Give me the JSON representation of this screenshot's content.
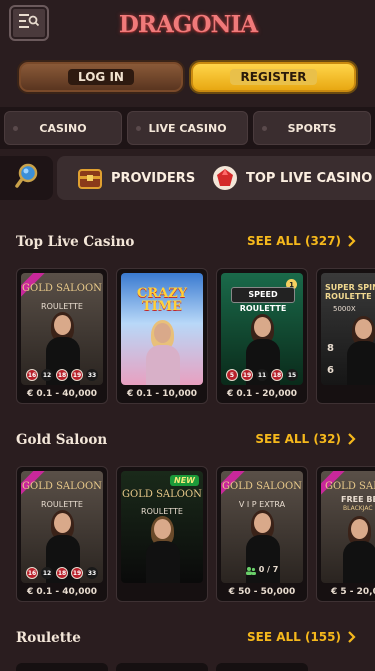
{
  "header": {
    "logo_text": "DRAGONIA",
    "menu_icon": "menu-list-icon"
  },
  "auth": {
    "login_label": "LOG IN",
    "register_label": "REGISTER"
  },
  "nav": {
    "tabs": [
      {
        "label": "CASINO"
      },
      {
        "label": "LIVE CASINO",
        "active": true
      },
      {
        "label": "SPORTS"
      }
    ]
  },
  "filters": {
    "search_icon": "magnifier-icon",
    "items": [
      {
        "label": "PROVIDERS",
        "icon": "chest-icon"
      },
      {
        "label": "TOP LIVE CASINO",
        "icon": "ruby-icon"
      }
    ]
  },
  "sections": [
    {
      "title": "Top Live Casino",
      "see_all": "SEE ALL (327)",
      "cards": [
        {
          "title": "GOLD SALOON",
          "subtitle": "ROULETTE",
          "balls": [
            "16",
            "12",
            "18",
            "19",
            "33"
          ],
          "limit": "€ 0.1 - 40,000",
          "ribbon": true
        },
        {
          "title": "CRAZY TIME",
          "limit": "€ 0.1 - 10,000"
        },
        {
          "title": "SPEED ROULETTE",
          "badge_number": "1",
          "balls": [
            "5",
            "19",
            "11",
            "18",
            "15"
          ],
          "limit": "€ 0.1 - 20,000"
        },
        {
          "title": "SUPER SPIN ROULETTE",
          "subtitle": "5000X",
          "balls": [
            "8",
            "6"
          ],
          "limit": ""
        }
      ]
    },
    {
      "title": "Gold Saloon",
      "see_all": "SEE ALL (32)",
      "cards": [
        {
          "title": "GOLD SALOON",
          "subtitle": "ROULETTE",
          "balls": [
            "16",
            "12",
            "18",
            "19",
            "33"
          ],
          "limit": "€ 0.1 - 40,000",
          "ribbon": true
        },
        {
          "title": "GOLD SALOON",
          "subtitle": "ROULETTE",
          "new": "NEW",
          "limit": ""
        },
        {
          "title": "GOLD SALOON",
          "subtitle": "V I P EXTRA",
          "seats": "0 / 7",
          "limit": "€ 50 - 50,000",
          "ribbon": true
        },
        {
          "title": "GOLD SAL",
          "subtitle": "FREE BE",
          "subtitle2": "BLACKJAC",
          "limit": "€ 5 - 20,0",
          "ribbon": true
        }
      ]
    },
    {
      "title": "Roulette",
      "see_all": "SEE ALL (155)"
    }
  ],
  "colors": {
    "background": "#2a1d1f",
    "accent": "#f5b81c",
    "register": "#ffd54a",
    "login": "#7a4a2a"
  }
}
